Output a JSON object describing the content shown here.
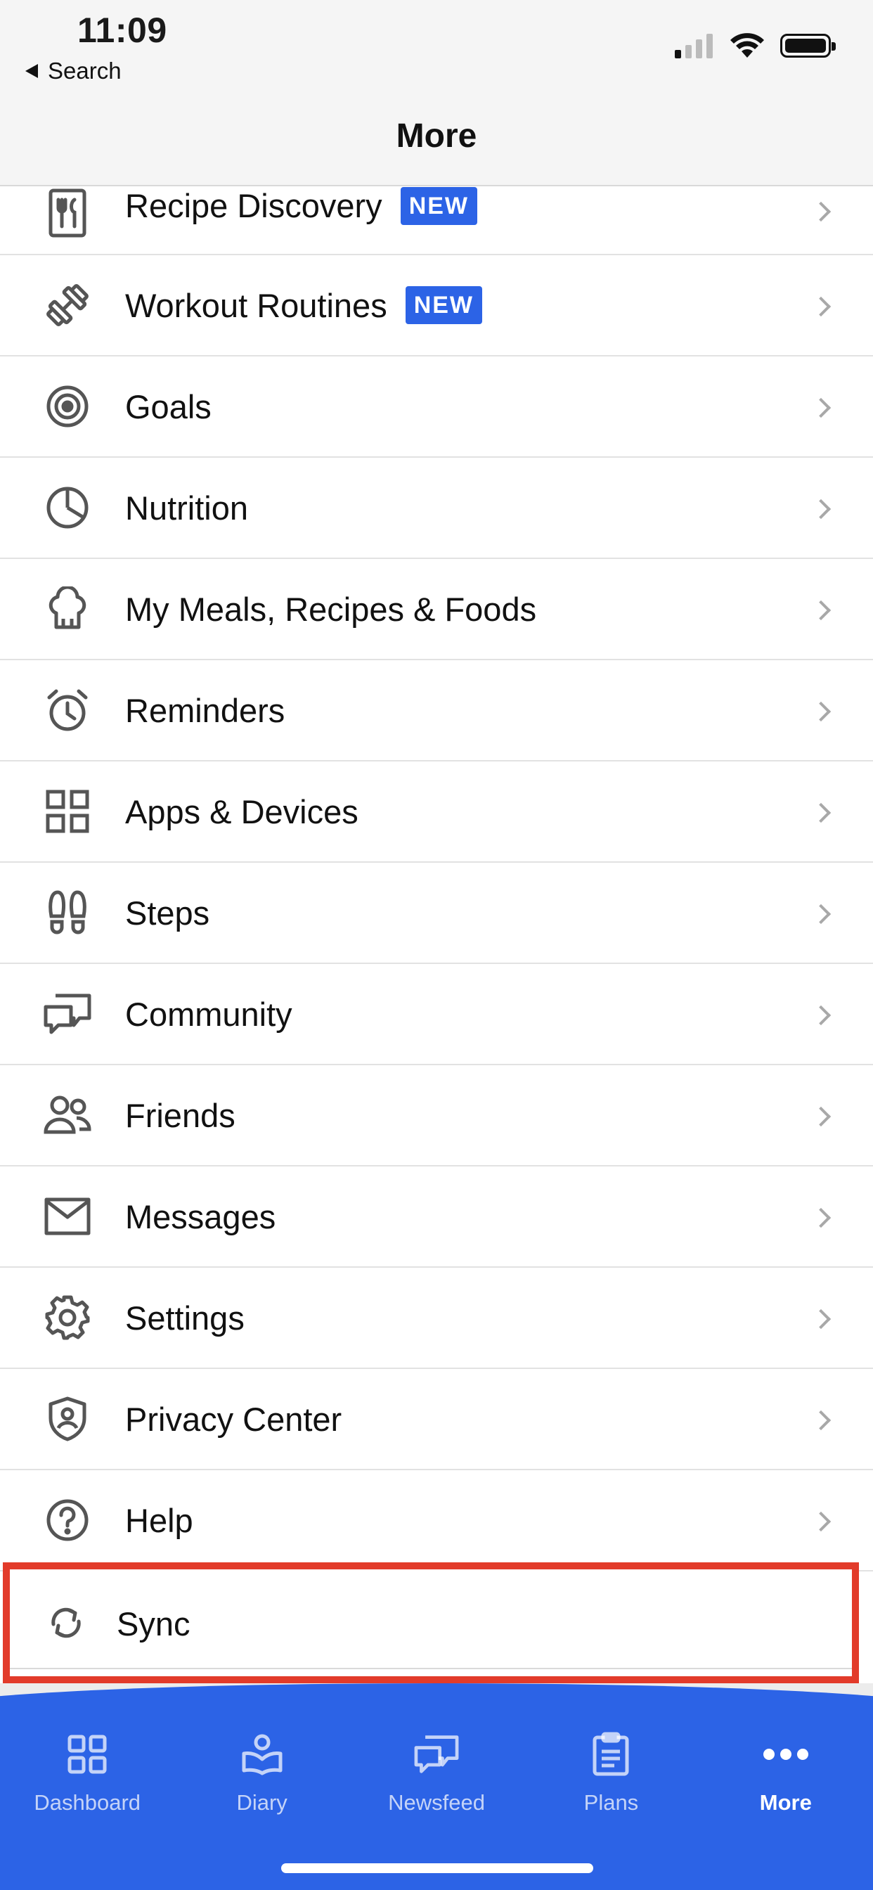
{
  "status": {
    "time": "11:09",
    "back_label": "Search"
  },
  "header": {
    "title": "More"
  },
  "menu": {
    "items": [
      {
        "label": "Recipe Discovery",
        "badge": "NEW",
        "icon": "recipe-icon"
      },
      {
        "label": "Workout Routines",
        "badge": "NEW",
        "icon": "dumbbell-icon"
      },
      {
        "label": "Goals",
        "icon": "target-icon"
      },
      {
        "label": "Nutrition",
        "icon": "pie-chart-icon"
      },
      {
        "label": "My Meals, Recipes & Foods",
        "icon": "chef-hat-icon"
      },
      {
        "label": "Reminders",
        "icon": "alarm-clock-icon"
      },
      {
        "label": "Apps & Devices",
        "icon": "grid-icon"
      },
      {
        "label": "Steps",
        "icon": "footprints-icon"
      },
      {
        "label": "Community",
        "icon": "chat-bubbles-icon"
      },
      {
        "label": "Friends",
        "icon": "people-icon"
      },
      {
        "label": "Messages",
        "icon": "envelope-icon"
      },
      {
        "label": "Settings",
        "icon": "gear-icon"
      },
      {
        "label": "Privacy Center",
        "icon": "shield-user-icon"
      },
      {
        "label": "Help",
        "icon": "question-circle-icon"
      }
    ],
    "sync_label": "Sync"
  },
  "tabbar": {
    "tabs": [
      {
        "label": "Dashboard",
        "icon": "dashboard-icon"
      },
      {
        "label": "Diary",
        "icon": "diary-icon"
      },
      {
        "label": "Newsfeed",
        "icon": "newsfeed-icon"
      },
      {
        "label": "Plans",
        "icon": "clipboard-icon"
      },
      {
        "label": "More",
        "icon": "more-dots-icon",
        "active": true
      }
    ]
  },
  "colors": {
    "brand_blue": "#2c63e6",
    "highlight_red": "#e23b2a",
    "icon_gray": "#555555"
  }
}
